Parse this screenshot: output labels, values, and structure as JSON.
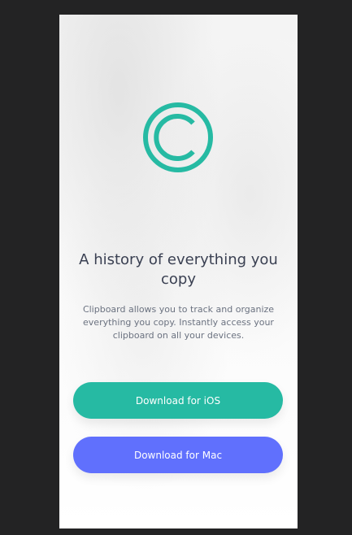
{
  "colors": {
    "page_background": "#232324",
    "card_background": "#f7f7f7",
    "accent_teal": "#26baa3",
    "accent_blue": "#6070fd",
    "title_text": "#3a4052",
    "body_text": "#6b7280"
  },
  "logo": {
    "icon": "copyright-icon"
  },
  "hero": {
    "title": "A history of everything you copy",
    "description": "Clipboard allows you to track and organize everything you copy. Instantly access your clipboard on all your devices."
  },
  "actions": {
    "ios_label": "Download for iOS",
    "mac_label": "Download for Mac"
  }
}
